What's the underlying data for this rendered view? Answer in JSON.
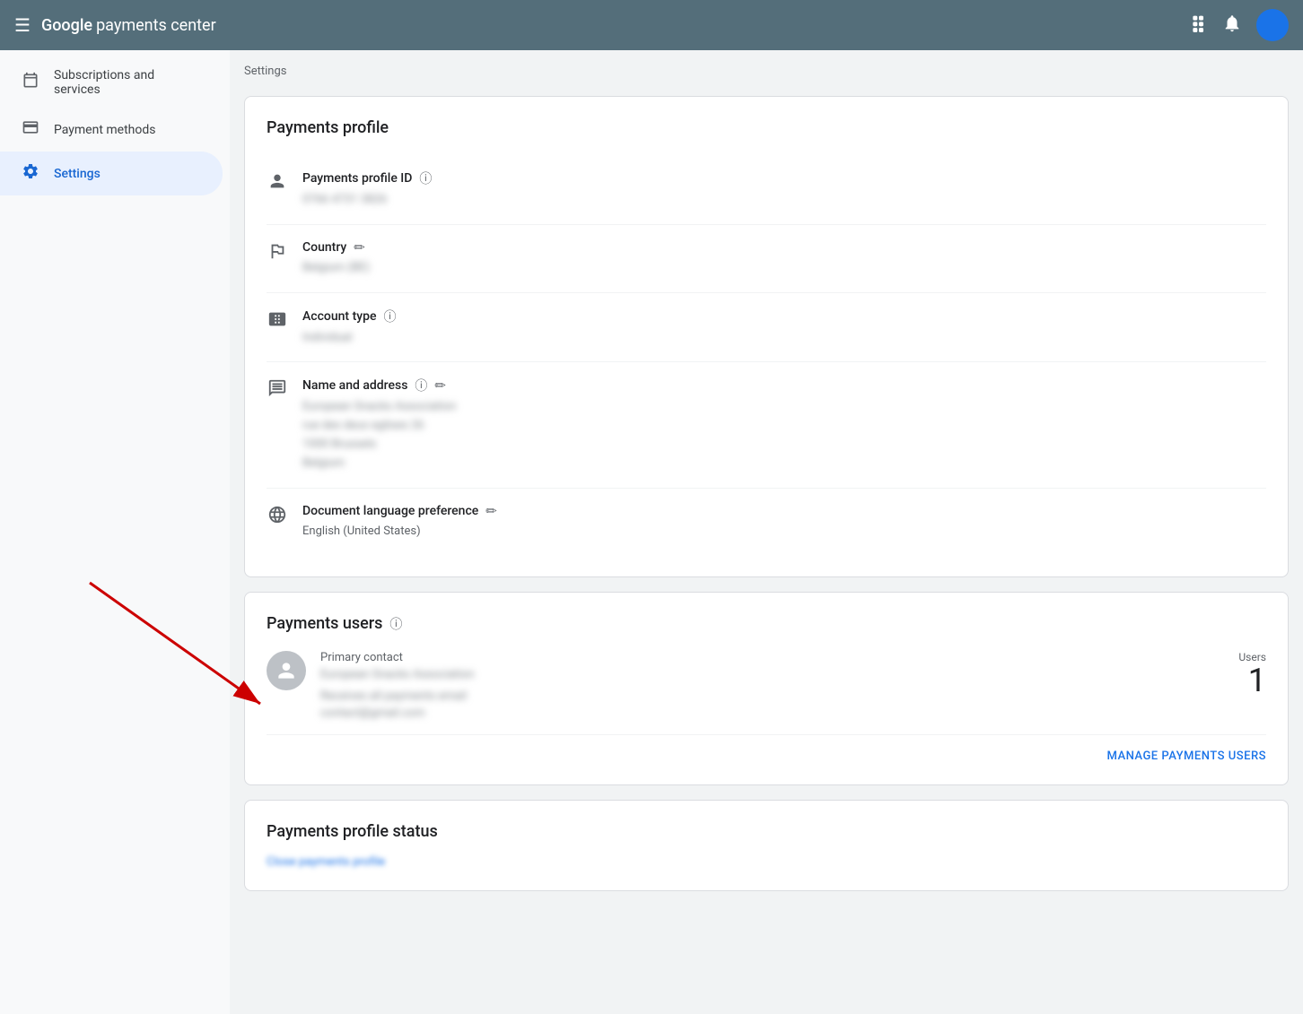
{
  "header": {
    "title": "payments center",
    "google_label": "Google",
    "hamburger_label": "Menu",
    "grid_label": "Apps",
    "bell_label": "Notifications"
  },
  "sidebar": {
    "items": [
      {
        "id": "subscriptions",
        "label": "Subscriptions and services",
        "icon": "calendar"
      },
      {
        "id": "payment-methods",
        "label": "Payment methods",
        "icon": "credit-card"
      },
      {
        "id": "settings",
        "label": "Settings",
        "icon": "gear",
        "active": true
      }
    ]
  },
  "breadcrumb": "Settings",
  "payments_profile": {
    "title": "Payments profile",
    "rows": [
      {
        "id": "profile-id",
        "label": "Payments profile ID",
        "info": true,
        "value": "0766 4731 3826",
        "blurred": true,
        "editable": false
      },
      {
        "id": "country",
        "label": "Country",
        "info": false,
        "value": "Belgium (BE)",
        "blurred": true,
        "editable": true
      },
      {
        "id": "account-type",
        "label": "Account type",
        "info": true,
        "value": "Individual",
        "blurred": true,
        "editable": false
      },
      {
        "id": "name-address",
        "label": "Name and address",
        "info": true,
        "value": "European Snacks Association\nrue des deux eglises 26\n1000 Brussels\nBelgium",
        "blurred": true,
        "editable": true
      },
      {
        "id": "doc-lang",
        "label": "Document language preference",
        "info": false,
        "value": "English (United States)",
        "blurred": false,
        "editable": true
      }
    ]
  },
  "payments_users": {
    "title": "Payments users",
    "info": true,
    "user": {
      "role": "Primary contact",
      "name": "European Snacks Association",
      "receives": "Receives all payments email",
      "email": "contact@gmail.com"
    },
    "users_label": "Users",
    "users_count": "1",
    "manage_label": "MANAGE PAYMENTS USERS"
  },
  "payments_profile_status": {
    "title": "Payments profile status",
    "link_label": "Close payments profile"
  },
  "icons": {
    "calendar": "&#x1F4C5;",
    "credit_card": "&#x1F4B3;",
    "gear": "⚙",
    "person": "👤",
    "flag": "🏳",
    "id_card": "🪪",
    "grid_view": "⊞",
    "globe": "🌐",
    "info": "ⓘ",
    "edit": "✏"
  }
}
